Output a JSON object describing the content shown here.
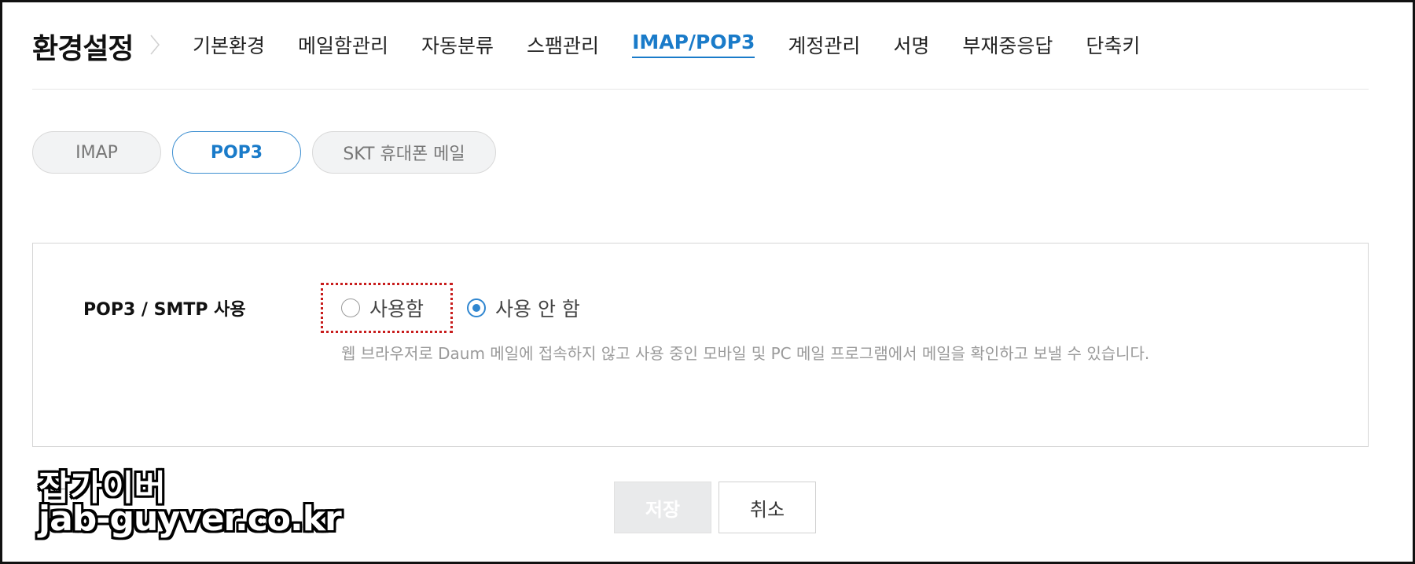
{
  "header": {
    "title": "환경설정",
    "nav": [
      {
        "label": "기본환경",
        "active": false
      },
      {
        "label": "메일함관리",
        "active": false
      },
      {
        "label": "자동분류",
        "active": false
      },
      {
        "label": "스팸관리",
        "active": false
      },
      {
        "label": "IMAP/POP3",
        "active": true
      },
      {
        "label": "계정관리",
        "active": false
      },
      {
        "label": "서명",
        "active": false
      },
      {
        "label": "부재중응답",
        "active": false
      },
      {
        "label": "단축키",
        "active": false
      }
    ]
  },
  "subtabs": [
    {
      "label": "IMAP",
      "active": false
    },
    {
      "label": "POP3",
      "active": true
    },
    {
      "label": "SKT 휴대폰 메일",
      "active": false
    }
  ],
  "settings": {
    "row_label": "POP3 / SMTP 사용",
    "options": [
      {
        "label": "사용함",
        "checked": false
      },
      {
        "label": "사용 안 함",
        "checked": true
      }
    ],
    "description": "웹 브라우저로 Daum 메일에 접속하지 않고 사용 중인 모바일 및 PC 메일 프로그램에서 메일을 확인하고 보낼 수 있습니다."
  },
  "buttons": {
    "save": "저장",
    "cancel": "취소"
  },
  "watermark": {
    "line1": "잡가이버",
    "line2": "jab-guyver.co.kr"
  },
  "colors": {
    "accent": "#1a7bc9",
    "highlight": "#c81d1d"
  }
}
